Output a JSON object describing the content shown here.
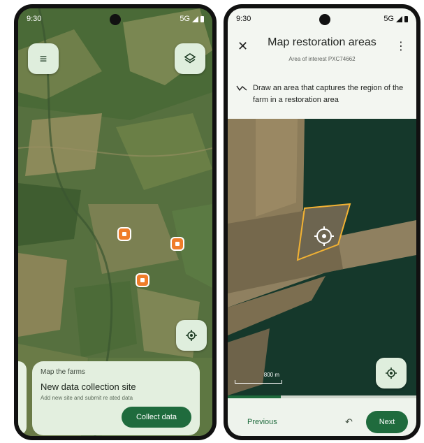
{
  "status": {
    "time": "9:30",
    "network": "5G"
  },
  "left_screen": {
    "card": {
      "kicker": "Map the farms",
      "title": "New data collection site",
      "subtitle": "Add new site and submit re ated data",
      "collect_button": "Collect data"
    }
  },
  "right_screen": {
    "title": "Map restoration areas",
    "subtitle": "Area of interest PXC74662",
    "instruction": "Draw an area that captures the region of the farm in a restoration area",
    "scale_label": "800 m",
    "progress": 0.28,
    "previous_label": "Previous",
    "next_label": "Next"
  },
  "icons": {
    "menu": "menu-icon",
    "layers": "layers-icon",
    "location": "location-icon",
    "close": "close-icon",
    "more": "more-vert-icon",
    "draw": "draw-polyline-icon",
    "undo": "undo-icon",
    "target": "target-icon"
  },
  "colors": {
    "primary": "#1f6b3d",
    "pin": "#ef7d2a",
    "polygon": "#f2b233",
    "surface": "#e3efdf"
  }
}
